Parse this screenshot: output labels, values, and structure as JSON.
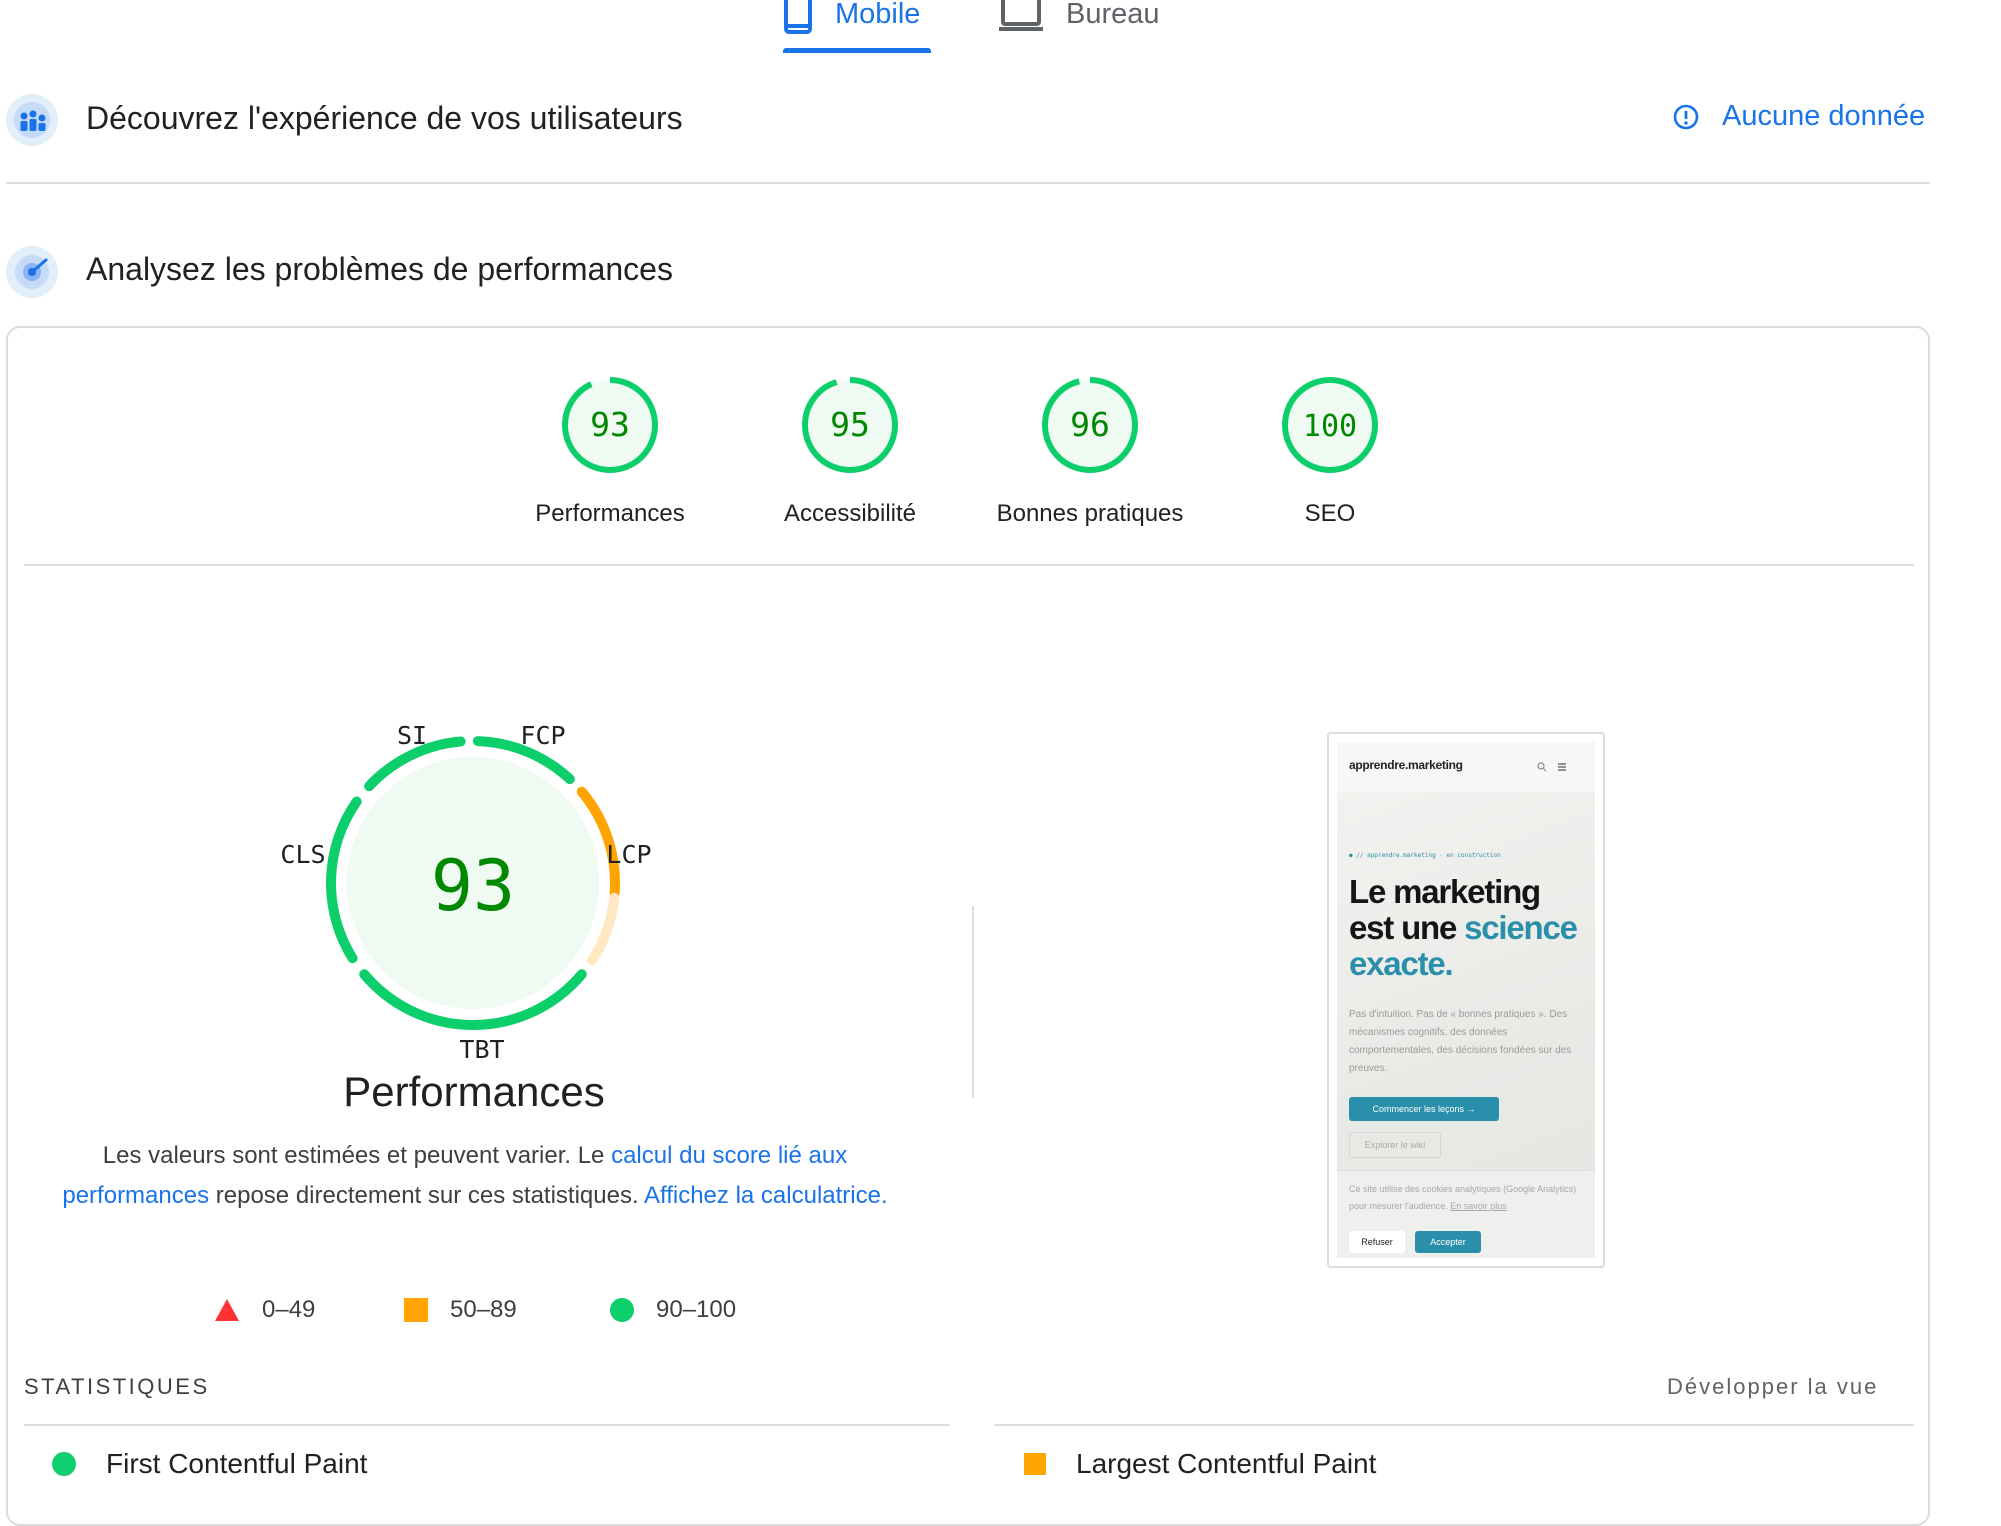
{
  "tabs": {
    "mobile": "Mobile",
    "desktop": "Bureau"
  },
  "field_section": {
    "title": "Découvrez l'expérience de vos utilisateurs",
    "no_data": "Aucune donnée"
  },
  "lab_section": {
    "title": "Analysez les problèmes de performances"
  },
  "scores": [
    {
      "value": "93",
      "label": "Performances",
      "fraction": 0.93
    },
    {
      "value": "95",
      "label": "Accessibilité",
      "fraction": 0.95
    },
    {
      "value": "96",
      "label": "Bonnes pratiques",
      "fraction": 0.96
    },
    {
      "value": "100",
      "label": "SEO",
      "fraction": 1.0
    }
  ],
  "big_gauge": {
    "score": "93",
    "title": "Performances",
    "segments": {
      "si": "SI",
      "fcp": "FCP",
      "lcp": "LCP",
      "tbt": "TBT",
      "cls": "CLS"
    }
  },
  "description": {
    "p1": "Les valeurs sont estimées et peuvent varier. Le ",
    "link1": "calcul du score lié aux performances",
    "p2": " repose directement sur ces statistiques. ",
    "link2": "Affichez la calculatrice."
  },
  "legend": [
    {
      "range": "0–49"
    },
    {
      "range": "50–89"
    },
    {
      "range": "90–100"
    }
  ],
  "stats": {
    "title": "STATISTIQUES",
    "expand": "Développer la vue",
    "metrics": [
      {
        "name": "First Contentful Paint"
      },
      {
        "name": "Largest Contentful Paint"
      }
    ]
  },
  "phone_preview": {
    "logo": "apprendre.marketing",
    "crumb": "● // apprendre.marketing · en construction",
    "headline_1": "Le marketing est une ",
    "headline_accent": "science exacte.",
    "text": "Pas d'intuition. Pas de « bonnes pratiques ». Des mécanismes cognitifs, des données comportementales, des décisions fondées sur des preuves.",
    "cta": "Commencer les leçons →",
    "cta2": "Explorer le wiki",
    "cookie_text": "Ce site utilise des cookies analytiques (Google Analytics) pour mesurer l'audience. ",
    "cookie_link": "En savoir plus",
    "refuse": "Refuser",
    "accept": "Accepter"
  },
  "colors": {
    "green": "#0cce6b",
    "green_text": "#008800",
    "orange": "#ffa400",
    "red": "#ff3333",
    "blue": "#1a73e8"
  }
}
